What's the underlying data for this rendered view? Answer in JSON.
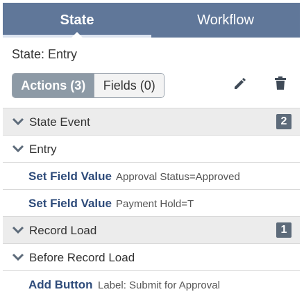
{
  "tabs": {
    "state_label": "State",
    "workflow_label": "Workflow"
  },
  "state_title": "State: Entry",
  "toggle": {
    "actions_label": "Actions (3)",
    "fields_label": "Fields (0)"
  },
  "toolbar": {
    "edit_icon": "pencil-icon",
    "delete_icon": "trash-icon"
  },
  "rows": {
    "state_event": {
      "label": "State Event",
      "count": "2"
    },
    "entry": {
      "label": "Entry"
    },
    "action1": {
      "name": "Set Field Value",
      "detail": "Approval Status=Approved"
    },
    "action2": {
      "name": "Set Field Value",
      "detail": "Payment Hold=T"
    },
    "record_load": {
      "label": "Record Load",
      "count": "1"
    },
    "before_record_load": {
      "label": "Before Record Load"
    },
    "action3": {
      "name": "Add Button",
      "detail": "Label: Submit for Approval"
    }
  },
  "colors": {
    "header_bg": "#607799",
    "active_toggle_bg": "#8d9aa6",
    "action_name": "#2e4b7a",
    "badge_bg": "#5d6b7a"
  }
}
